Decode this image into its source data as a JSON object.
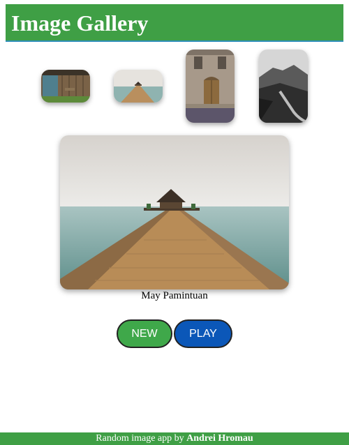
{
  "header": {
    "title": "Image Gallery"
  },
  "thumbnails": [
    {
      "name": "wooden-cabin-thumbnail"
    },
    {
      "name": "pier-thumbnail"
    },
    {
      "name": "old-building-door-thumbnail"
    },
    {
      "name": "mountain-road-thumbnail"
    }
  ],
  "main": {
    "author": "May Pamintuan"
  },
  "buttons": {
    "new_label": "NEW",
    "play_label": "PLAY"
  },
  "footer": {
    "prefix": "Random image app by ",
    "author": "Andrei Hromau"
  },
  "colors": {
    "brand_green": "#3f9f45",
    "play_blue": "#0b57b8",
    "new_green": "#3fa84a"
  }
}
